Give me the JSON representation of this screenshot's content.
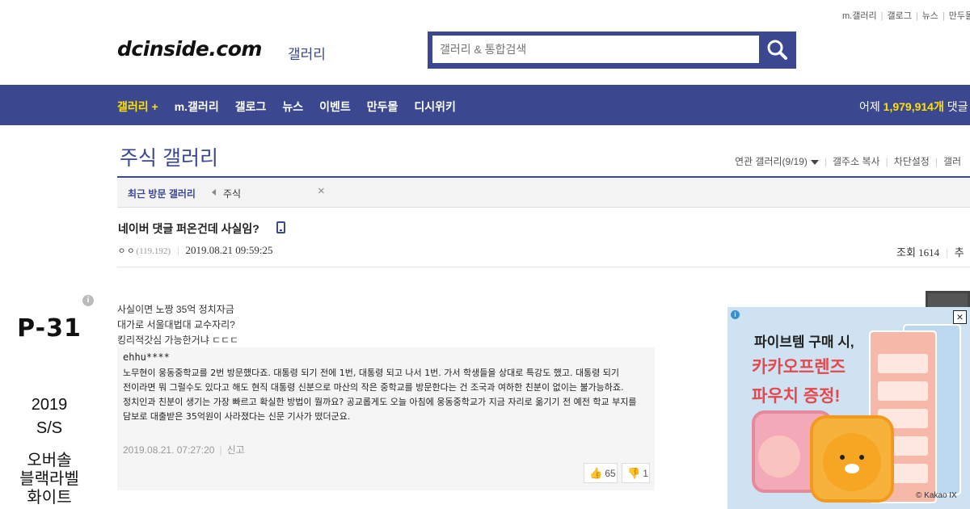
{
  "top_links": [
    "m.갤러리",
    "갤로그",
    "뉴스",
    "만두몰"
  ],
  "logo": {
    "text": "dcinside.com",
    "sub": "갤러리"
  },
  "search": {
    "placeholder": "갤러리 & 통합검색"
  },
  "nav": {
    "items": [
      "갤러리 +",
      "m.갤러리",
      "갤로그",
      "뉴스",
      "이벤트",
      "만두몰",
      "디시위키"
    ],
    "stat_prefix": "어제",
    "stat_count": "1,979,914개",
    "stat_suffix": "댓글"
  },
  "gallery": {
    "title": "주식 갤러리",
    "menu": [
      "연관 갤러리(9/19)",
      "갤주소 복사",
      "차단설정",
      "갤러"
    ]
  },
  "recent": {
    "label": "최근 방문 갤러리",
    "item": "주식",
    "close": "×"
  },
  "post": {
    "title": "네이버 댓글 퍼온건데 사실임?",
    "writer": "ㅇㅇ",
    "ip": "(119.192)",
    "date": "2019.08.21 09:59:25",
    "views_label": "조회 1614",
    "recommend_label": "추",
    "body_lines": [
      "사실이면 노짱 35억 정치자금",
      "대가로 서울대법대 교수자리?",
      "킹리적갓심 가능한거냐 ㄷㄷㄷ"
    ]
  },
  "quote": {
    "writer": "ehhu****",
    "text": "노무현이 웅동중학교를 2번 방문했다죠. 대통령 되기 전에 1번, 대통령 되고 나서 1번. 가서 학생들을 상대로 특강도 했고. 대통령 되기 전이라면 뭐 그럴수도 있다고 해도 현직 대통령 신분으로 마산의 작은 중학교를 방문한다는 건 조국과 여하한 친분이 없이는 불가능하죠. 정치인과 친분이 생기는 가장 빠르고 확실한 방법이 뭘까요? 공교롭게도 오늘 아침에 웅동중학교가 지금 자리로 옮기기 전 예전 학교 부지를 담보로 대출받은 35억원이 사라졌다는 신문 기사가 떴더군요.",
    "date": "2019.08.21. 07:27:20",
    "report": "신고",
    "up_count": "65",
    "down_count": "1"
  },
  "left_ad": {
    "brand": "P-31",
    "season_line1": "2019",
    "season_line2": "S/S",
    "product_line1": "오버솔",
    "product_line2": "블랙라벨",
    "product_line3": "화이트",
    "info": "i"
  },
  "right_ad": {
    "line1": "파이브템 구매 시,",
    "line2": "카카오프렌즈",
    "line3": "파우치 증정!",
    "copyright": "© Kakao IX",
    "info": "i"
  },
  "colors": {
    "brand_blue": "#3b4890",
    "highlight_yellow": "#ffe100",
    "ad_red": "#e5484d"
  }
}
